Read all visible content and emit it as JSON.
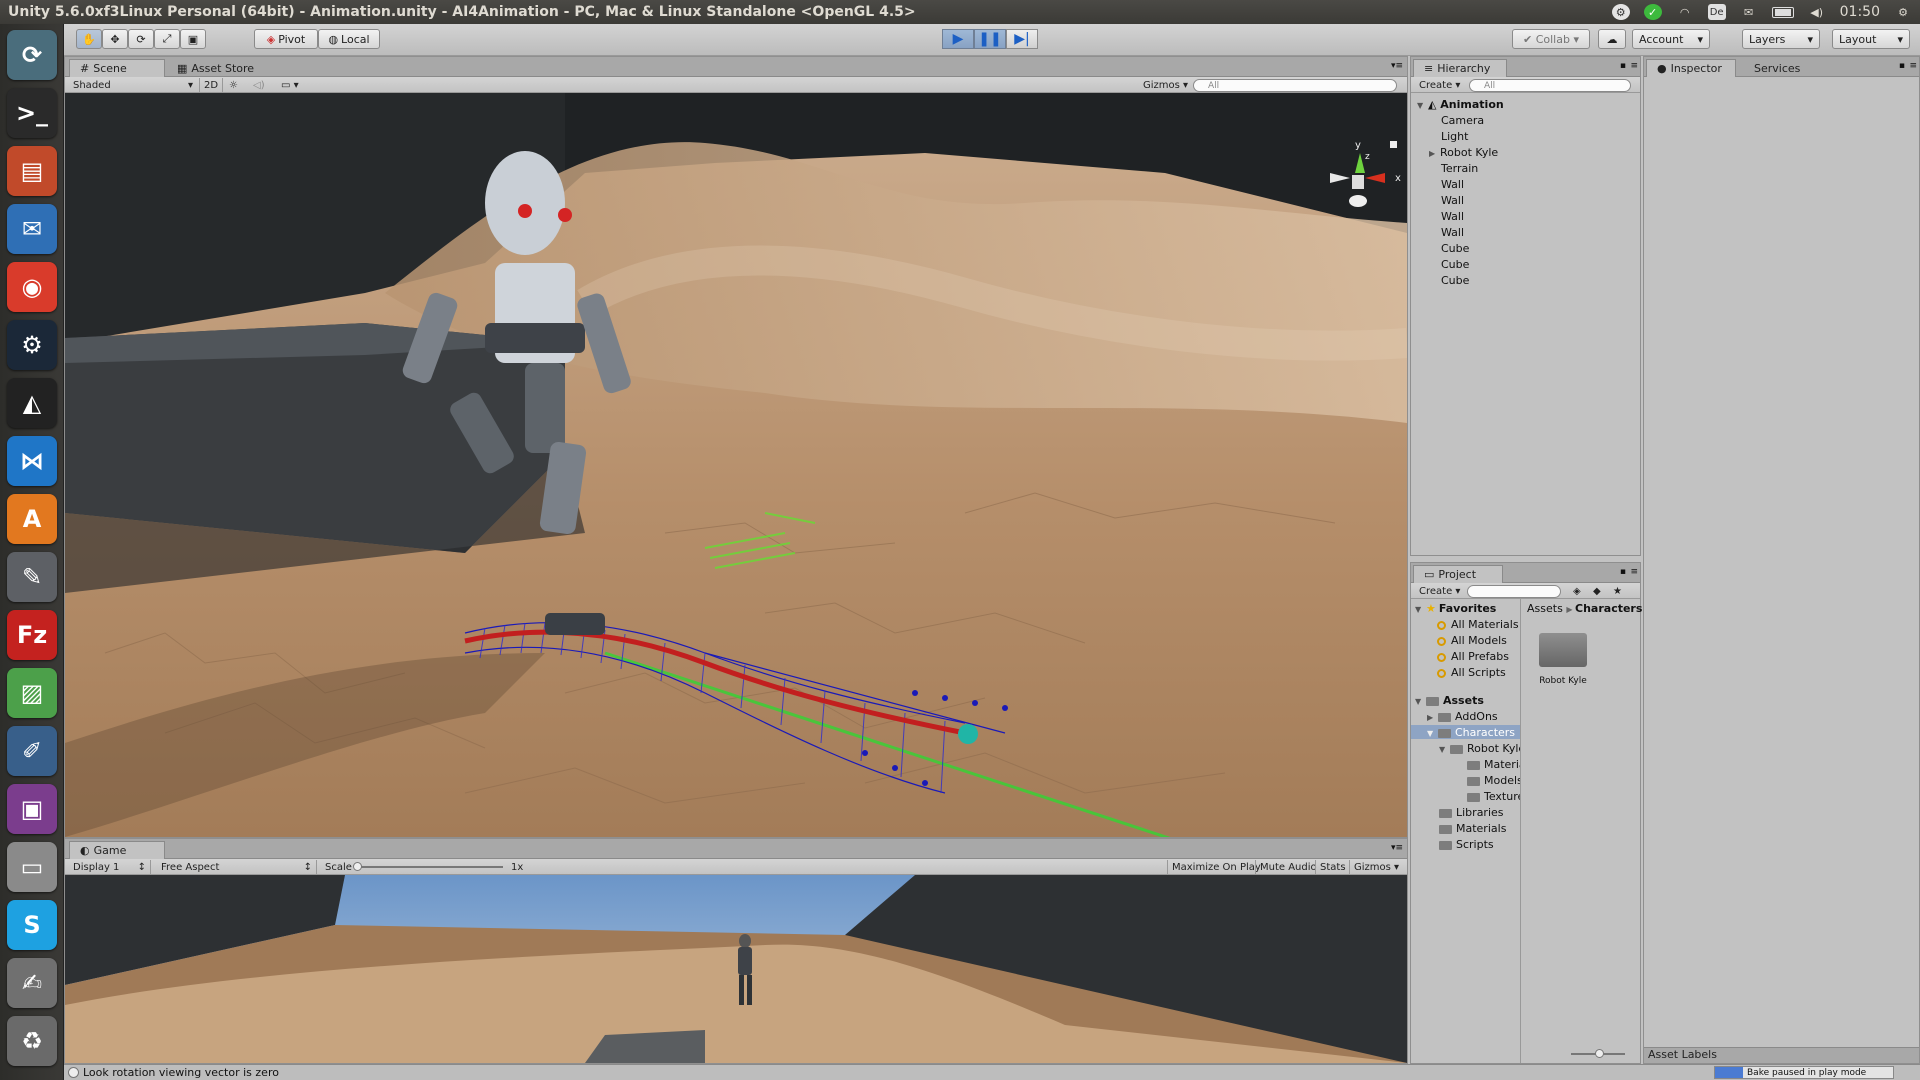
{
  "window_title": "Unity 5.6.0xf3Linux Personal (64bit) - Animation.unity - AI4Animation - PC, Mac & Linux Standalone <OpenGL 4.5>",
  "system_tray": {
    "keyboard": "De",
    "time": "01:50"
  },
  "launcher": {
    "items": [
      {
        "name": "system-settings-icon",
        "glyph": "⟳",
        "color": "#4a6d7c"
      },
      {
        "name": "terminal-icon",
        "glyph": ">_",
        "color": "#2a2a2a"
      },
      {
        "name": "files-icon",
        "glyph": "▤",
        "color": "#c14a2a"
      },
      {
        "name": "thunderbird-icon",
        "glyph": "✉",
        "color": "#2f6fb5"
      },
      {
        "name": "chrome-icon",
        "glyph": "◉",
        "color": "#d93b2b"
      },
      {
        "name": "steam-icon",
        "glyph": "⚙",
        "color": "#1b2838"
      },
      {
        "name": "unity-icon",
        "glyph": "◭",
        "color": "#222222"
      },
      {
        "name": "vscode-icon",
        "glyph": "⋈",
        "color": "#1f76c7"
      },
      {
        "name": "software-center-icon",
        "glyph": "A",
        "color": "#e2781f"
      },
      {
        "name": "settings-icon",
        "glyph": "✎",
        "color": "#5d6065"
      },
      {
        "name": "filezilla-icon",
        "glyph": "Fz",
        "color": "#c4221f"
      },
      {
        "name": "pdf-shuffler-icon",
        "glyph": "▨",
        "color": "#4ca04a"
      },
      {
        "name": "text-editor-icon",
        "glyph": "✐",
        "color": "#385f8a"
      },
      {
        "name": "media-icon",
        "glyph": "▣",
        "color": "#7b3d8d"
      },
      {
        "name": "drive-icon",
        "glyph": "▭",
        "color": "#8a8a8a"
      },
      {
        "name": "skype-icon",
        "glyph": "S",
        "color": "#1ea1e1"
      },
      {
        "name": "notes-icon",
        "glyph": "✍",
        "color": "#707070"
      },
      {
        "name": "trash-icon",
        "glyph": "♻",
        "color": "#6a6a6a"
      }
    ]
  },
  "toolbar": {
    "pivot": "Pivot",
    "local": "Local",
    "collab": "Collab",
    "account": "Account",
    "layers": "Layers",
    "layout": "Layout"
  },
  "scene": {
    "tab_scene": "Scene",
    "tab_asset_store": "Asset Store",
    "shading": "Shaded",
    "mode_2d": "2D",
    "gizmos": "Gizmos",
    "search_placeholder": "All",
    "axis_y": "y",
    "axis_x": "x",
    "axis_z": "z"
  },
  "game": {
    "tab": "Game",
    "display": "Display 1",
    "aspect": "Free Aspect",
    "scale_label": "Scale",
    "scale_value": "1x",
    "maximize": "Maximize On Play",
    "mute": "Mute Audio",
    "stats": "Stats",
    "gizmos": "Gizmos"
  },
  "hierarchy": {
    "tab": "Hierarchy",
    "create": "Create",
    "search_placeholder": "All",
    "scene_name": "Animation",
    "items": [
      "Camera",
      "Light",
      "Robot Kyle",
      "Terrain",
      "Wall",
      "Wall",
      "Wall",
      "Wall",
      "Cube",
      "Cube",
      "Cube"
    ]
  },
  "inspector": {
    "tab": "Inspector",
    "services_tab": "Services"
  },
  "project": {
    "tab": "Project",
    "create": "Create",
    "favorites_label": "Favorites",
    "favorites": [
      "All Materials",
      "All Models",
      "All Prefabs",
      "All Scripts"
    ],
    "assets_label": "Assets",
    "tree": [
      {
        "label": "AddOns",
        "indent": 1
      },
      {
        "label": "Characters",
        "indent": 1
      },
      {
        "label": "Robot Kyle",
        "indent": 2
      },
      {
        "label": "Materials",
        "indent": 3
      },
      {
        "label": "Models",
        "indent": 3
      },
      {
        "label": "Textures",
        "indent": 3
      },
      {
        "label": "Libraries",
        "indent": 1
      },
      {
        "label": "Materials",
        "indent": 1
      },
      {
        "label": "Scripts",
        "indent": 1
      }
    ],
    "breadcrumb_root": "Assets",
    "breadcrumb_current": "Characters",
    "grid_item": "Robot Kyle",
    "asset_labels": "Asset Labels"
  },
  "status": {
    "message": "Look rotation viewing vector is zero",
    "bake": "Bake paused in play mode"
  }
}
